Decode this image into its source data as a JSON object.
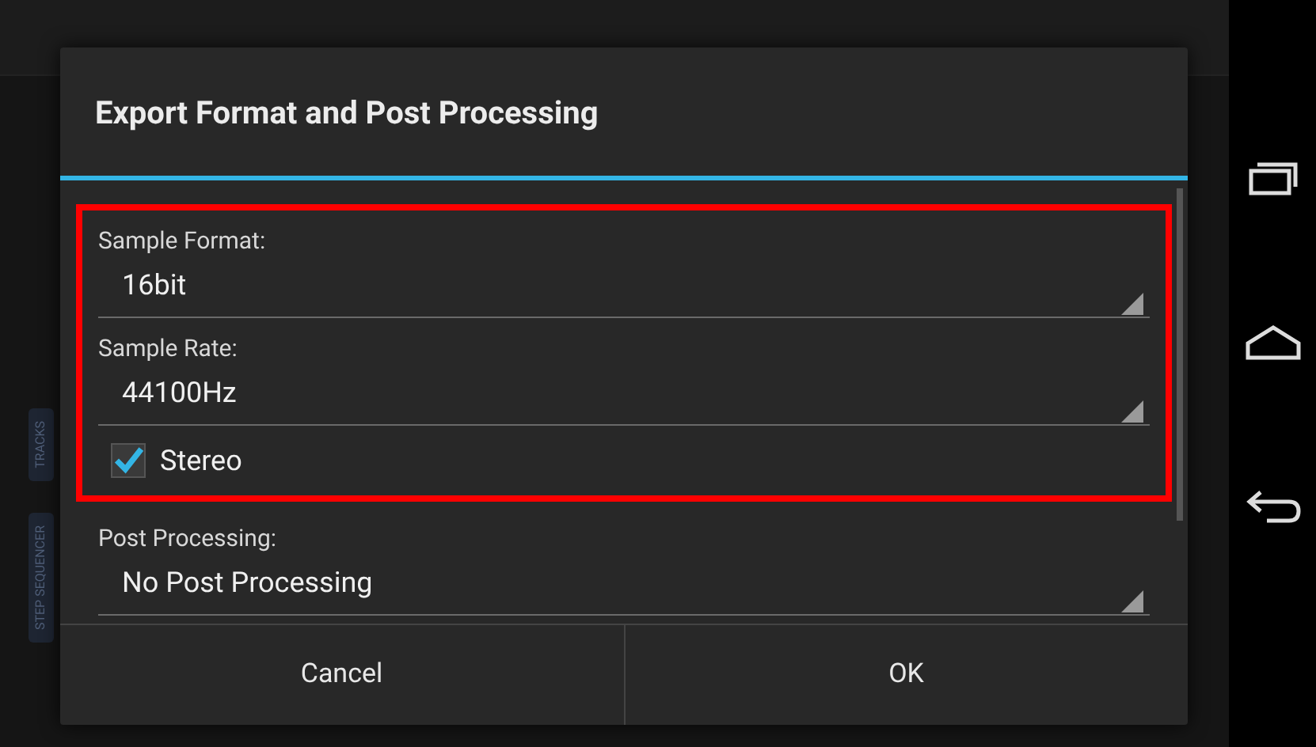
{
  "background_app": {
    "side_tabs": [
      "TRACKS",
      "STEP SEQUENCER"
    ]
  },
  "dialog": {
    "title": "Export Format and Post Processing",
    "sections": [
      {
        "highlighted": true,
        "items": [
          {
            "kind": "dropdown",
            "label": "Sample Format:",
            "value": "16bit"
          },
          {
            "kind": "dropdown",
            "label": "Sample Rate:",
            "value": "44100Hz"
          },
          {
            "kind": "checkbox",
            "label": "Stereo",
            "checked": true
          }
        ]
      },
      {
        "highlighted": false,
        "items": [
          {
            "kind": "dropdown",
            "label": "Post Processing:",
            "value": "No Post Processing"
          }
        ]
      }
    ],
    "buttons": [
      "Cancel",
      "OK"
    ]
  }
}
